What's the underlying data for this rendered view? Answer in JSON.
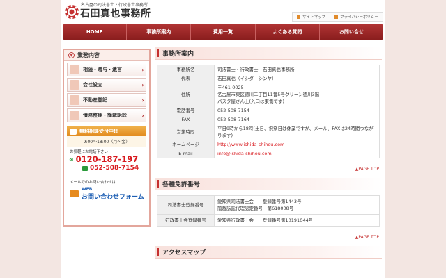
{
  "header": {
    "subtitle": "名古屋の司法書士・行政書士事務所",
    "title": "石田真也事務所",
    "links": [
      "サイトマップ",
      "プライバシーポリシー"
    ]
  },
  "nav": [
    "HOME",
    "事務所案内",
    "費用一覧",
    "よくある質問",
    "お問い合せ"
  ],
  "sidebar": {
    "heading": "業務内容",
    "items": [
      "相続・贈与・遺言",
      "会社設立",
      "不動産登記",
      "債務整理・簡裁訴訟"
    ],
    "consult": "無料相談受付中!!",
    "hours": "9:00〜18:00（月〜金）",
    "call_note": "お気軽にお電話下さい！",
    "freedial": "0120-187-197",
    "tel": "052-508-7154",
    "mail_note": "メールでのお問い合わせは",
    "web_small": "WEB",
    "web_big": "お問い合わせフォーム"
  },
  "office": {
    "title": "事務所案内",
    "rows": [
      {
        "label": "事務所名",
        "value": "司法書士・行政書士　石田真也事務所"
      },
      {
        "label": "代表",
        "value": "石田真也（イシダ　シンヤ）"
      },
      {
        "label": "住所",
        "value": "〒461-0025\n名古屋市東区徳川二丁目11番5号グリーン徳川3階\nバスタ屋さん上(入口は東側です)"
      },
      {
        "label": "電話番号",
        "value": "052-508-7154"
      },
      {
        "label": "FAX",
        "value": "052-508-7164"
      },
      {
        "label": "営業時間",
        "value": "平日9時から18時(土日、祝祭日は休業ですが、メール、FAXは24時間つながります)"
      },
      {
        "label": "ホームページ",
        "value": "http://www.ishida-shihou.com"
      },
      {
        "label": "E-mail",
        "value": "info@ishida-shihou.com"
      }
    ],
    "pagetop": "▲PAGE TOP"
  },
  "licenses": {
    "title": "各種免許番号",
    "rows": [
      {
        "label": "司法書士登録番号",
        "value": "愛知県司法書士会　　登録番号第1443号\n簡裁訴訟代理認定番号　第618008号"
      },
      {
        "label": "行政書士会登録番号",
        "value": "愛知県行政書士会　　登録番号第10191044号"
      }
    ],
    "pagetop": "▲PAGE TOP"
  },
  "access": {
    "title": "アクセスマップ"
  }
}
